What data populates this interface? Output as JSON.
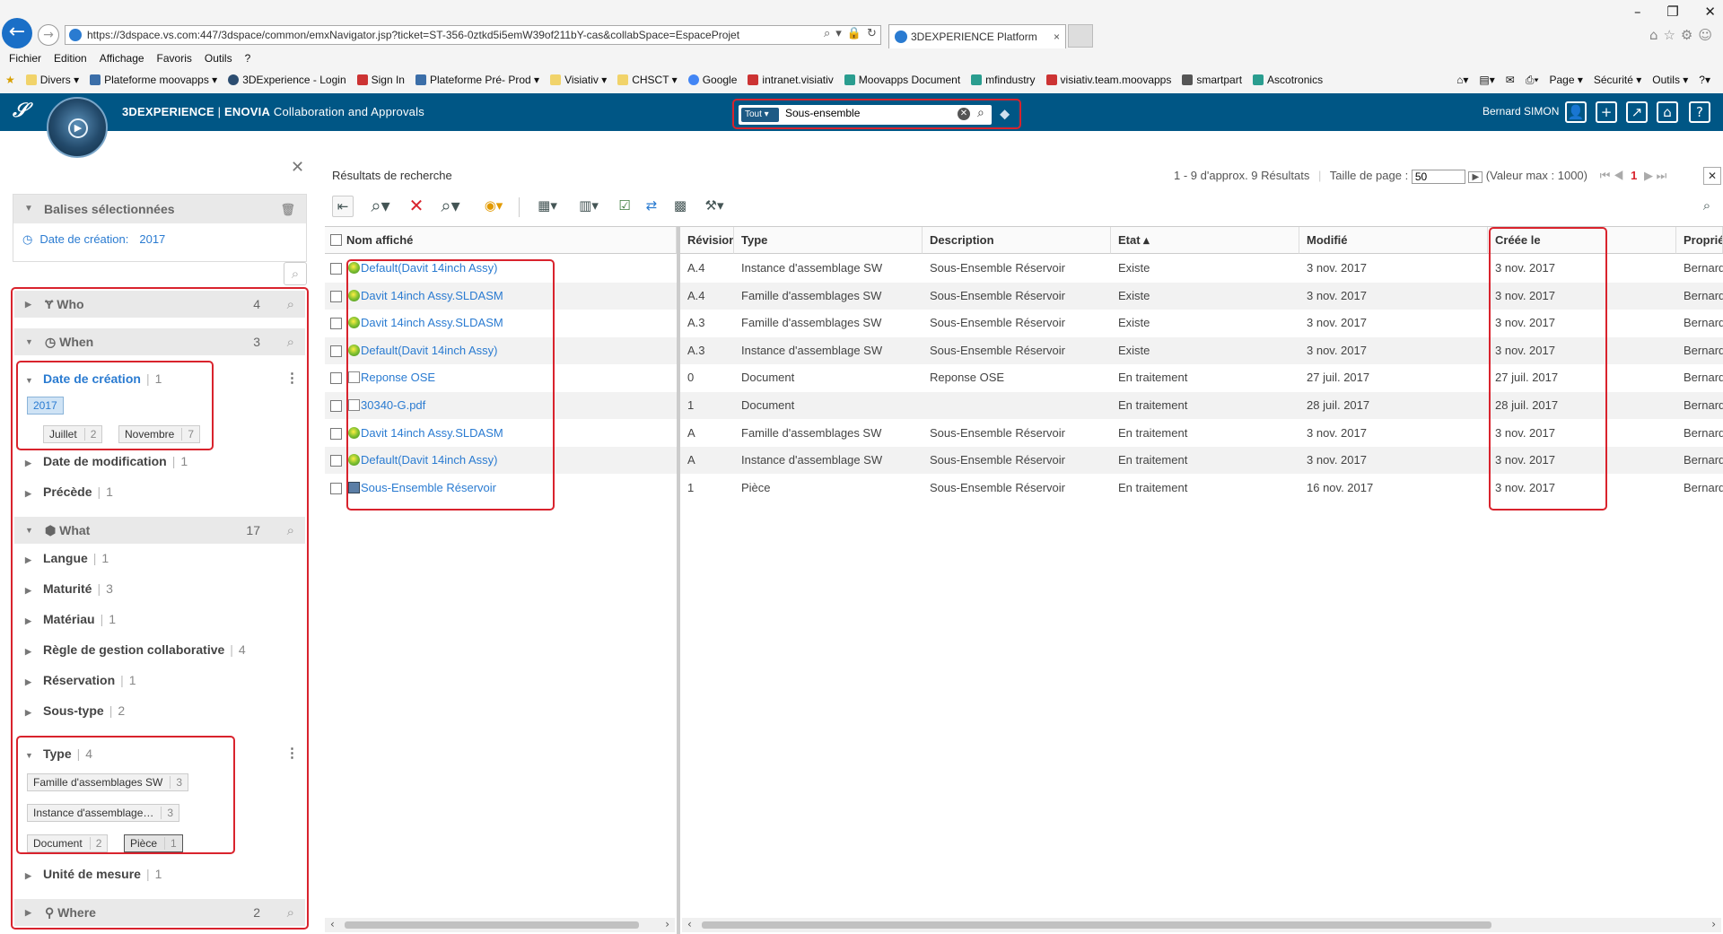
{
  "browser": {
    "url": "https://3dspace.vs.com:447/3dspace/common/emxNavigator.jsp?ticket=ST-356-0ztkd5i5emW39of211bY-cas&collabSpace=EspaceProjet",
    "tab_title": "3DEXPERIENCE Platform",
    "menu": [
      "Fichier",
      "Edition",
      "Affichage",
      "Favoris",
      "Outils",
      "?"
    ],
    "favorites": [
      "Divers ▾",
      "Plateforme moovapps ▾",
      "3DExperience - Login",
      "Sign In",
      "Plateforme Pré- Prod ▾",
      "Visiativ ▾",
      "CHSCT ▾",
      "Google",
      "intranet.visiativ",
      "Moovapps Document",
      "mfindustry",
      "visiativ.team.moovapps",
      "smartpart",
      "Ascotronics"
    ],
    "right_tools": [
      "Page ▾",
      "Sécurité ▾",
      "Outils ▾"
    ]
  },
  "header": {
    "brand": "3DEXPERIENCE",
    "app": "ENOVIA",
    "subtitle": "Collaboration and Approvals",
    "search_scope": "Tout",
    "search_value": "Sous-ensemble",
    "user": "Bernard SIMON"
  },
  "left": {
    "balises_title": "Balises sélectionnées",
    "tag_label": "Date de création:",
    "tag_value": "2017",
    "who": {
      "label": "Who",
      "count": "4"
    },
    "when": {
      "label": "When",
      "count": "3"
    },
    "date_creation": {
      "label": "Date de création",
      "count": "1",
      "year": "2017",
      "months": [
        {
          "name": "Juillet",
          "count": "2"
        },
        {
          "name": "Novembre",
          "count": "7"
        }
      ]
    },
    "date_modif": {
      "label": "Date de modification",
      "count": "1"
    },
    "precede": {
      "label": "Précède",
      "count": "1"
    },
    "what": {
      "label": "What",
      "count": "17"
    },
    "what_items": [
      {
        "label": "Langue",
        "count": "1"
      },
      {
        "label": "Maturité",
        "count": "3"
      },
      {
        "label": "Matériau",
        "count": "1"
      },
      {
        "label": "Règle de gestion collaborative",
        "count": "4"
      },
      {
        "label": "Réservation",
        "count": "1"
      },
      {
        "label": "Sous-type",
        "count": "2"
      }
    ],
    "type": {
      "label": "Type",
      "count": "4",
      "chips": [
        {
          "name": "Famille d'assemblages SW",
          "count": "3"
        },
        {
          "name": "Instance d'assemblage…",
          "count": "3"
        },
        {
          "name": "Document",
          "count": "2"
        },
        {
          "name": "Pièce",
          "count": "1"
        }
      ]
    },
    "unite": {
      "label": "Unité de mesure",
      "count": "1"
    },
    "where": {
      "label": "Where",
      "count": "2"
    }
  },
  "results": {
    "title": "Résultats de recherche",
    "summary": "1 - 9 d'approx. 9 Résultats",
    "page_size_label": "Taille de page :",
    "page_size": "50",
    "max_label": "(Valeur max : 1000)",
    "page": "1",
    "columns": [
      "Nom affiché",
      "Révision",
      "Type",
      "Description",
      "Etat ▴",
      "Modifié",
      "Créée le",
      "Propriétaire"
    ],
    "rows": [
      {
        "name": "Default(Davit 14inch Assy)",
        "rev": "A.4",
        "type": "Instance d'assemblage SW",
        "desc": "Sous-Ensemble Réservoir",
        "etat": "Existe",
        "mod": "3 nov. 2017",
        "cree": "3 nov. 2017",
        "owner": "Bernard SIMON",
        "icon": "dot"
      },
      {
        "name": "Davit 14inch Assy.SLDASM",
        "rev": "A.4",
        "type": "Famille d'assemblages SW",
        "desc": "Sous-Ensemble Réservoir",
        "etat": "Existe",
        "mod": "3 nov. 2017",
        "cree": "3 nov. 2017",
        "owner": "Bernard SIMON",
        "icon": "dot"
      },
      {
        "name": "Davit 14inch Assy.SLDASM",
        "rev": "A.3",
        "type": "Famille d'assemblages SW",
        "desc": "Sous-Ensemble Réservoir",
        "etat": "Existe",
        "mod": "3 nov. 2017",
        "cree": "3 nov. 2017",
        "owner": "Bernard SIMON",
        "icon": "dot"
      },
      {
        "name": "Default(Davit 14inch Assy)",
        "rev": "A.3",
        "type": "Instance d'assemblage SW",
        "desc": "Sous-Ensemble Réservoir",
        "etat": "Existe",
        "mod": "3 nov. 2017",
        "cree": "3 nov. 2017",
        "owner": "Bernard SIMON",
        "icon": "dot"
      },
      {
        "name": "Reponse OSE",
        "rev": "0",
        "type": "Document",
        "desc": "Reponse OSE",
        "etat": "En traitement",
        "mod": "27 juil. 2017",
        "cree": "27 juil. 2017",
        "owner": "Bernard SIMON",
        "icon": "doc"
      },
      {
        "name": "30340-G.pdf",
        "rev": "1",
        "type": "Document",
        "desc": "",
        "etat": "En traitement",
        "mod": "28 juil. 2017",
        "cree": "28 juil. 2017",
        "owner": "Bernard SIMON",
        "icon": "doc"
      },
      {
        "name": "Davit 14inch Assy.SLDASM",
        "rev": "A",
        "type": "Famille d'assemblages SW",
        "desc": "Sous-Ensemble Réservoir",
        "etat": "En traitement",
        "mod": "3 nov. 2017",
        "cree": "3 nov. 2017",
        "owner": "Bernard SIMON",
        "icon": "dot"
      },
      {
        "name": "Default(Davit 14inch Assy)",
        "rev": "A",
        "type": "Instance d'assemblage SW",
        "desc": "Sous-Ensemble Réservoir",
        "etat": "En traitement",
        "mod": "3 nov. 2017",
        "cree": "3 nov. 2017",
        "owner": "Bernard SIMON",
        "icon": "dot"
      },
      {
        "name": "Sous-Ensemble Réservoir",
        "rev": "1",
        "type": "Pièce",
        "desc": "Sous-Ensemble Réservoir",
        "etat": "En traitement",
        "mod": "16 nov. 2017",
        "cree": "3 nov. 2017",
        "owner": "Bernard SIMON",
        "icon": "part"
      }
    ]
  }
}
